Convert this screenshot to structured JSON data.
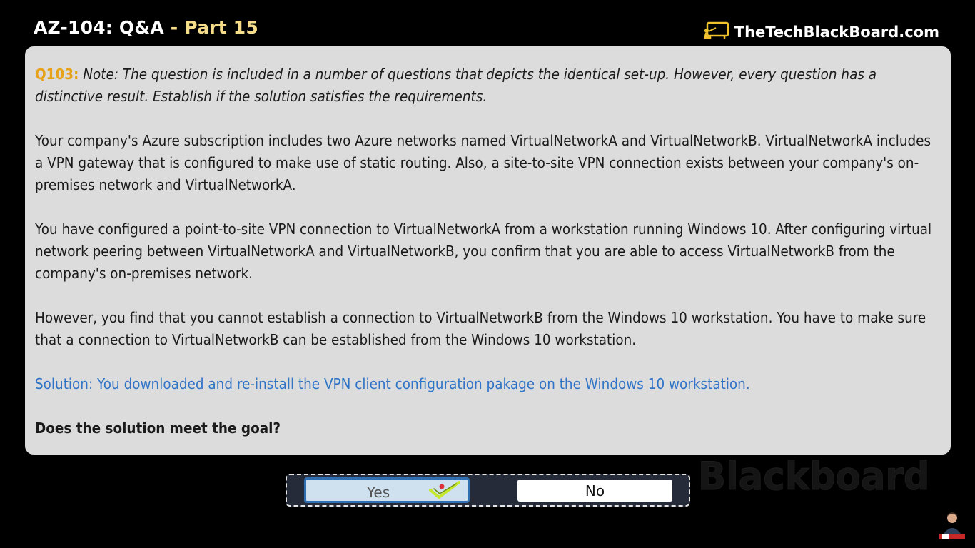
{
  "header": {
    "title_main": "AZ-104: Q&A",
    "title_separator": " - ",
    "title_part": "Part 15",
    "brand": "TheTechBlackBoard.com"
  },
  "question": {
    "number": "Q103:",
    "note": "Note: The question is included in a number of questions that depicts the identical set-up. However, every question has a distinctive result. Establish if the solution satisfies the requirements.",
    "paragraph1": "Your company's Azure subscription includes two Azure networks named VirtualNetworkA and VirtualNetworkB. VirtualNetworkA includes a VPN gateway that is configured to make use of static routing. Also, a site-to-site VPN connection exists between your company's on- premises network and VirtualNetworkA.",
    "paragraph2": "You have configured a point-to-site VPN connection to VirtualNetworkA from a workstation running Windows 10. After configuring virtual network peering between VirtualNetworkA and VirtualNetworkB, you confirm that you are able to access VirtualNetworkB from the company's on-premises network.",
    "paragraph3": "However, you find that you cannot establish a connection to VirtualNetworkB from the Windows 10 workstation. You have to make sure that a connection to VirtualNetworkB can be established from the Windows 10 workstation.",
    "solution": "Solution: You downloaded and re-install the VPN client configuration pakage on the Windows 10 workstation.",
    "prompt": "Does the solution meet the goal?"
  },
  "answers": {
    "yes_label": "Yes",
    "no_label": "No",
    "selected": "Yes"
  },
  "watermark": "Blackboard",
  "icons": {
    "brand": "blackboard-logo-icon",
    "check": "checkmark-icon",
    "avatar": "presenter-avatar-icon"
  },
  "colors": {
    "background": "#000000",
    "card": "#dcdcdc",
    "question_number": "#e8a21a",
    "solution": "#2f74c7",
    "title_part": "#f5dc8a",
    "brand_icon": "#f2c12e",
    "yes_border": "#2f6fb1",
    "check": "#c6e82b"
  }
}
